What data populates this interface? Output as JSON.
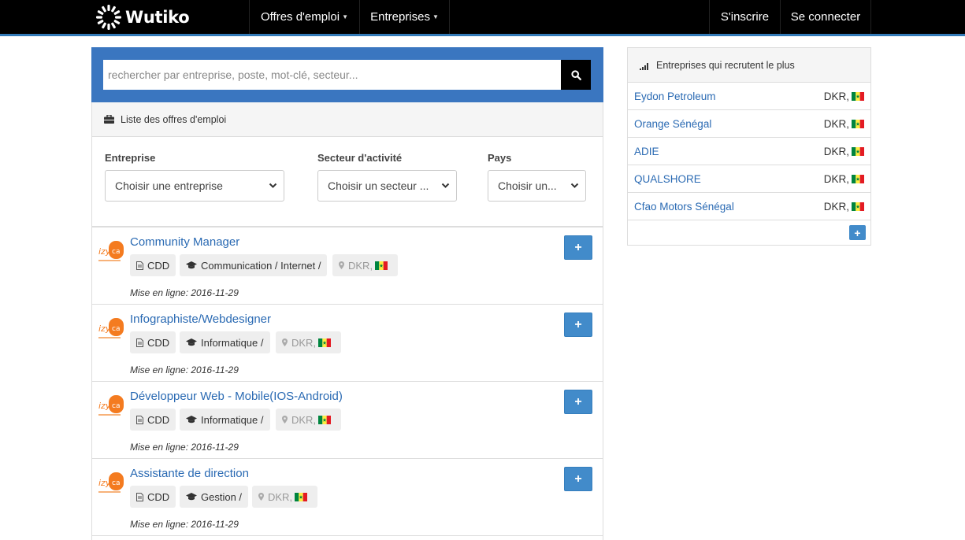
{
  "navbar": {
    "brand": "Wutiko",
    "menu": [
      {
        "label": "Offres d'emploi"
      },
      {
        "label": "Entreprises"
      }
    ],
    "signup": "S'inscrire",
    "login": "Se connecter",
    "accent_color": "#337ab7"
  },
  "search": {
    "placeholder": "rechercher par entreprise, poste, mot-clé, secteur...",
    "button_icon": "search-icon"
  },
  "list_panel": {
    "heading": "Liste des offres d'emploi",
    "icon": "briefcase-icon"
  },
  "filters": {
    "company": {
      "label": "Entreprise",
      "value": "Choisir une entreprise"
    },
    "sector": {
      "label": "Secteur d'activité",
      "value": "Choisir un secteur ..."
    },
    "country": {
      "label": "Pays",
      "value": "Choisir un..."
    }
  },
  "jobs": [
    {
      "title": "Community Manager",
      "contract": "CDD",
      "sector": "Communication / Internet /",
      "location": "DKR,",
      "date": "Mise en ligne: 2016-11-29",
      "action": "+"
    },
    {
      "title": "Infographiste/Webdesigner",
      "contract": "CDD",
      "sector": "Informatique /",
      "location": "DKR,",
      "date": "Mise en ligne: 2016-11-29",
      "action": "+"
    },
    {
      "title": "Développeur Web - Mobile(IOS-Android)",
      "contract": "CDD",
      "sector": "Informatique /",
      "location": "DKR,",
      "date": "Mise en ligne: 2016-11-29",
      "action": "+"
    },
    {
      "title": "Assistante de direction",
      "contract": "CDD",
      "sector": "Gestion /",
      "location": "DKR,",
      "date": "Mise en ligne: 2016-11-29",
      "action": "+"
    }
  ],
  "sidebar": {
    "heading": "Entreprises qui recrutent le plus",
    "icon": "signal-bars-icon",
    "companies": [
      {
        "name": "Eydon Petroleum",
        "location": "DKR,"
      },
      {
        "name": "Orange Sénégal",
        "location": "DKR,"
      },
      {
        "name": "ADIE",
        "location": "DKR,"
      },
      {
        "name": "QUALSHORE",
        "location": "DKR,"
      },
      {
        "name": "Cfao Motors Sénégal",
        "location": "DKR,"
      }
    ],
    "more": "+"
  },
  "colors": {
    "link": "#2a6ab3",
    "search_band": "#3a76c0",
    "button": "#428bca"
  }
}
